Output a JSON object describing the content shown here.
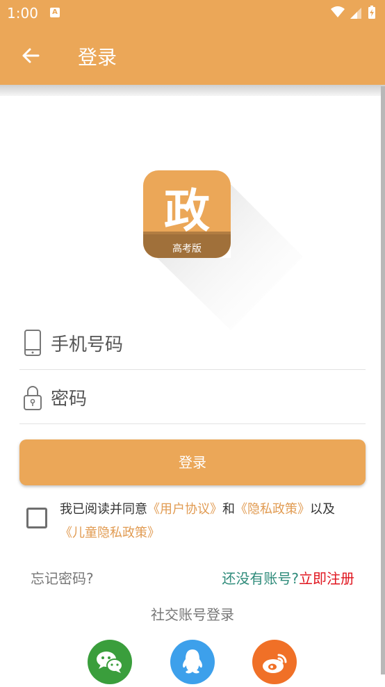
{
  "statusbar": {
    "time": "1:00"
  },
  "appbar": {
    "title": "登录"
  },
  "logo": {
    "main": "政",
    "sub": "高考版"
  },
  "form": {
    "phone_placeholder": "手机号码",
    "password_placeholder": "密码",
    "login_label": "登录"
  },
  "agreement": {
    "prefix": "我已阅读并同意",
    "user_agreement": "《用户协议》",
    "and": "和",
    "privacy_policy": "《隐私政策》",
    "also": "以及",
    "child_policy": "《儿童隐私政策》"
  },
  "links": {
    "forgot": "忘记密码?",
    "no_account": "还没有账号?",
    "register": "立即注册"
  },
  "social": {
    "title": "社交账号登录",
    "items": [
      {
        "name": "wechat",
        "color": "#3A9E3C"
      },
      {
        "name": "qq",
        "color": "#3DA0EB"
      },
      {
        "name": "weibo",
        "color": "#F07027"
      }
    ]
  },
  "colors": {
    "primary": "#EBA758",
    "accent_link": "#E19B52",
    "register": "#E0141E",
    "question": "#2E8B7A"
  }
}
